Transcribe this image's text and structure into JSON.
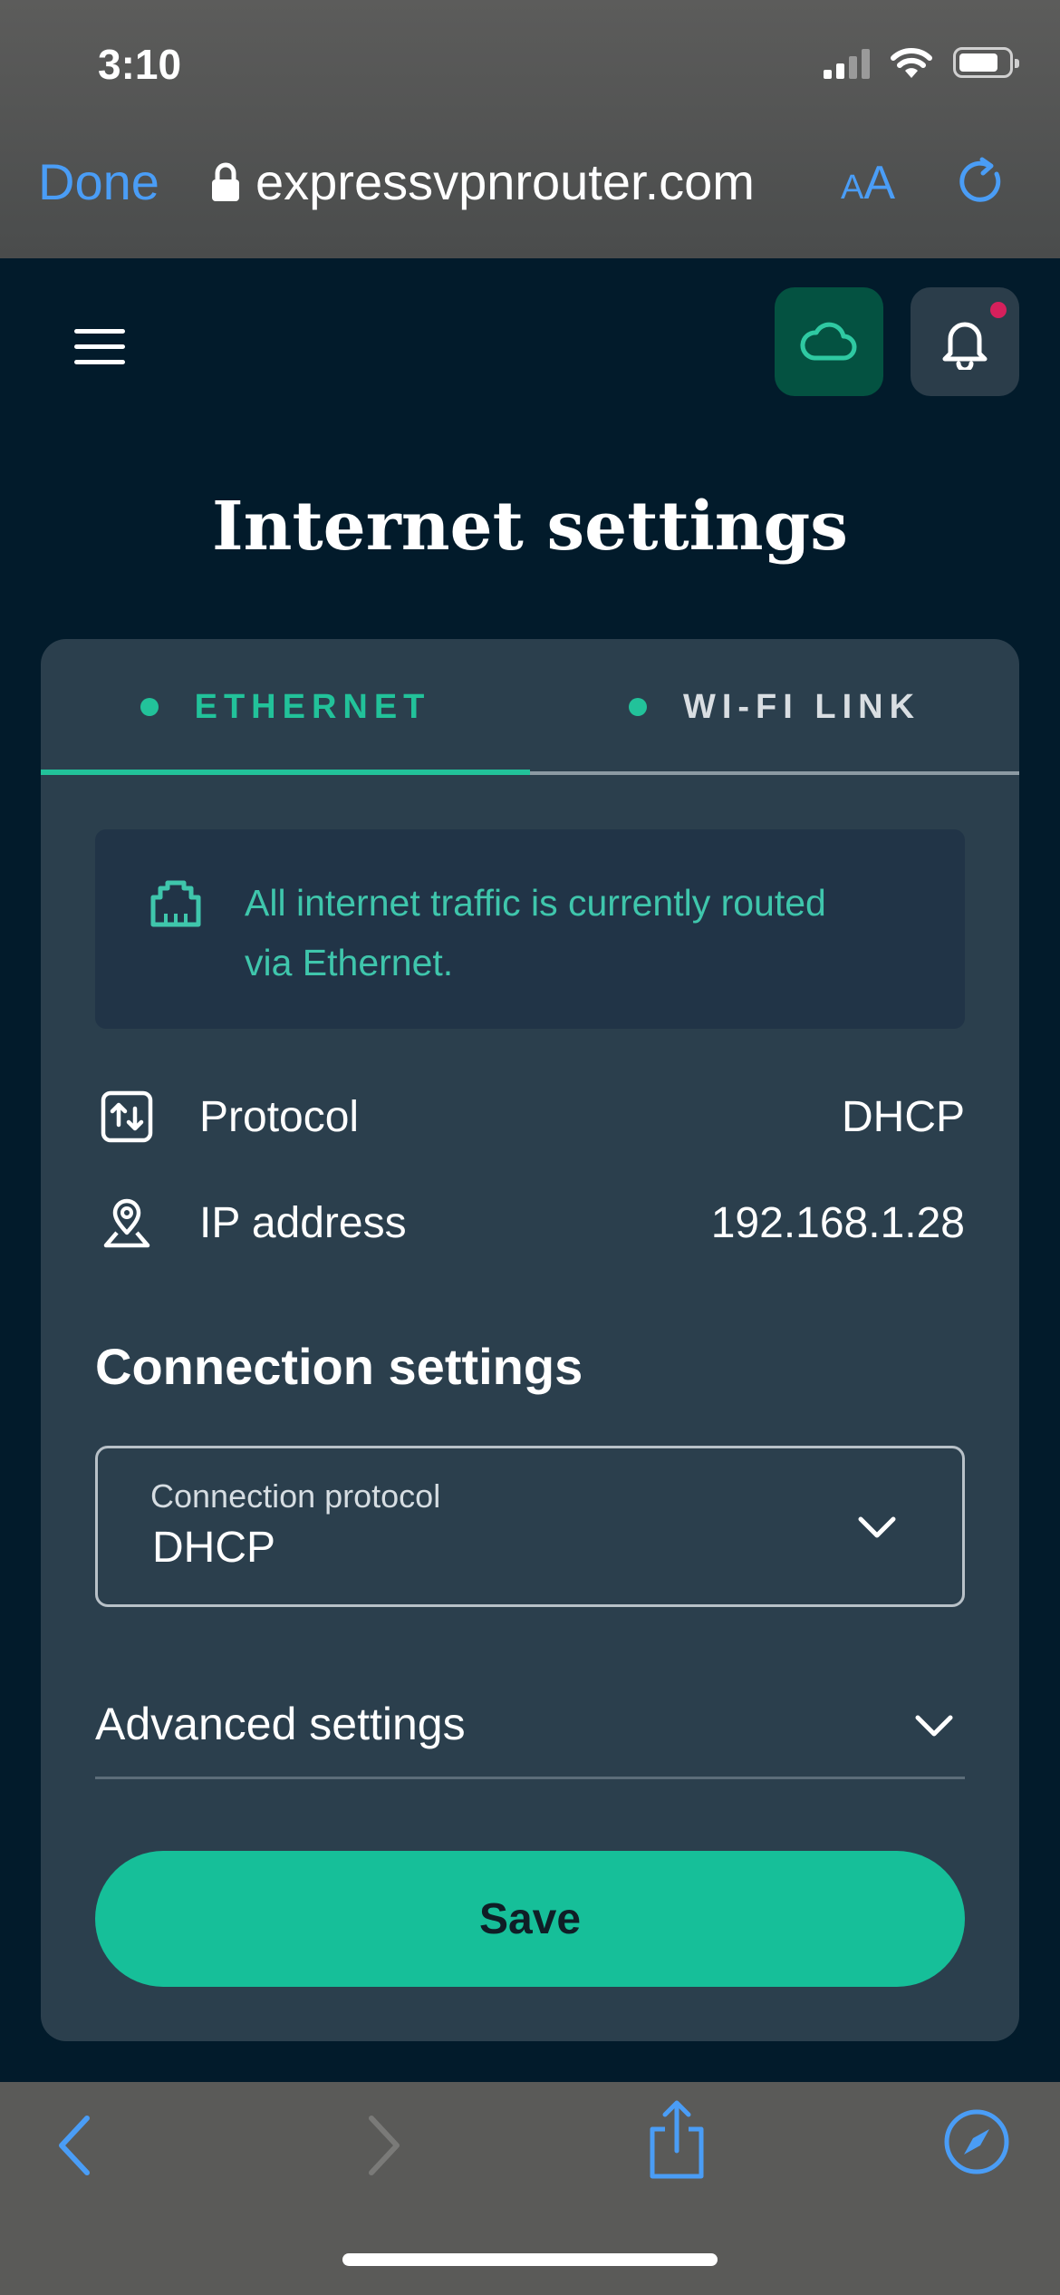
{
  "status_bar": {
    "time": "3:10"
  },
  "browser": {
    "done_label": "Done",
    "url": "expressvpnrouter.com",
    "text_size_label_small": "A",
    "text_size_label_big": "A"
  },
  "header": {
    "title": "Internet settings",
    "notification_dot_color": "#d6205c"
  },
  "tabs": [
    {
      "label": "ETHERNET",
      "active": true
    },
    {
      "label": "WI-FI LINK",
      "active": false
    }
  ],
  "notice": {
    "line1": "All internet traffic is currently routed",
    "line2": "via Ethernet."
  },
  "info": {
    "protocol_label": "Protocol",
    "protocol_value": "DHCP",
    "ip_label": "IP address",
    "ip_value": "192.168.1.28"
  },
  "connection_settings": {
    "title": "Connection settings",
    "select_label": "Connection protocol",
    "select_value": "DHCP"
  },
  "advanced": {
    "label": "Advanced settings"
  },
  "actions": {
    "save_label": "Save"
  },
  "colors": {
    "accent": "#16bf99",
    "page_bg": "#021b2b",
    "card_bg": "#2b3f4d",
    "link_blue": "#4a9df6"
  }
}
